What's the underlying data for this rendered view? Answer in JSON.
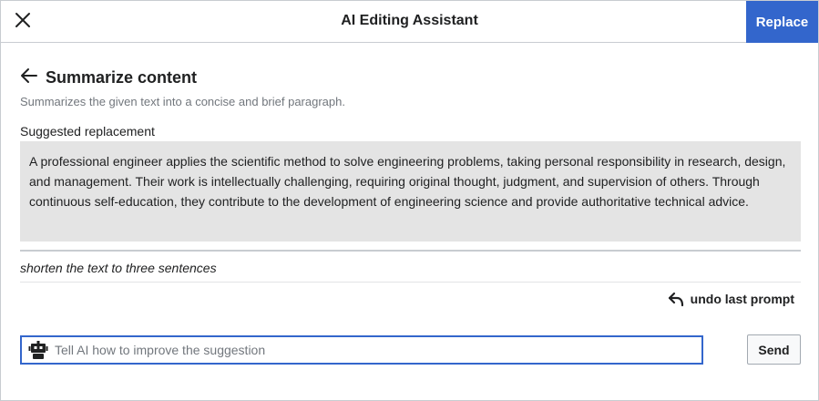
{
  "header": {
    "title": "AI Editing Assistant",
    "replace_label": "Replace"
  },
  "section": {
    "title": "Summarize content",
    "description": "Summarizes the given text into a concise and brief paragraph."
  },
  "suggestion": {
    "label": "Suggested replacement",
    "text": "A professional engineer applies the scientific method to solve engineering problems, taking personal responsibility in research, design, and management. Their work is intellectually challenging, requiring original thought, judgment, and supervision of others. Through continuous self-education, they contribute to the development of engineering science and provide authoritative technical advice."
  },
  "prompt_history": {
    "last_prompt": "shorten the text to three sentences"
  },
  "undo": {
    "label": "undo last prompt"
  },
  "input": {
    "placeholder": "Tell AI how to improve the suggestion",
    "value": ""
  },
  "send": {
    "label": "Send"
  },
  "icons": {
    "close": "close-icon",
    "back": "arrow-left-icon",
    "undo": "undo-icon",
    "robot": "robot-icon"
  },
  "colors": {
    "accent": "#3366cc",
    "suggestion_bg": "#e4e4e4",
    "muted_text": "#72777d"
  }
}
